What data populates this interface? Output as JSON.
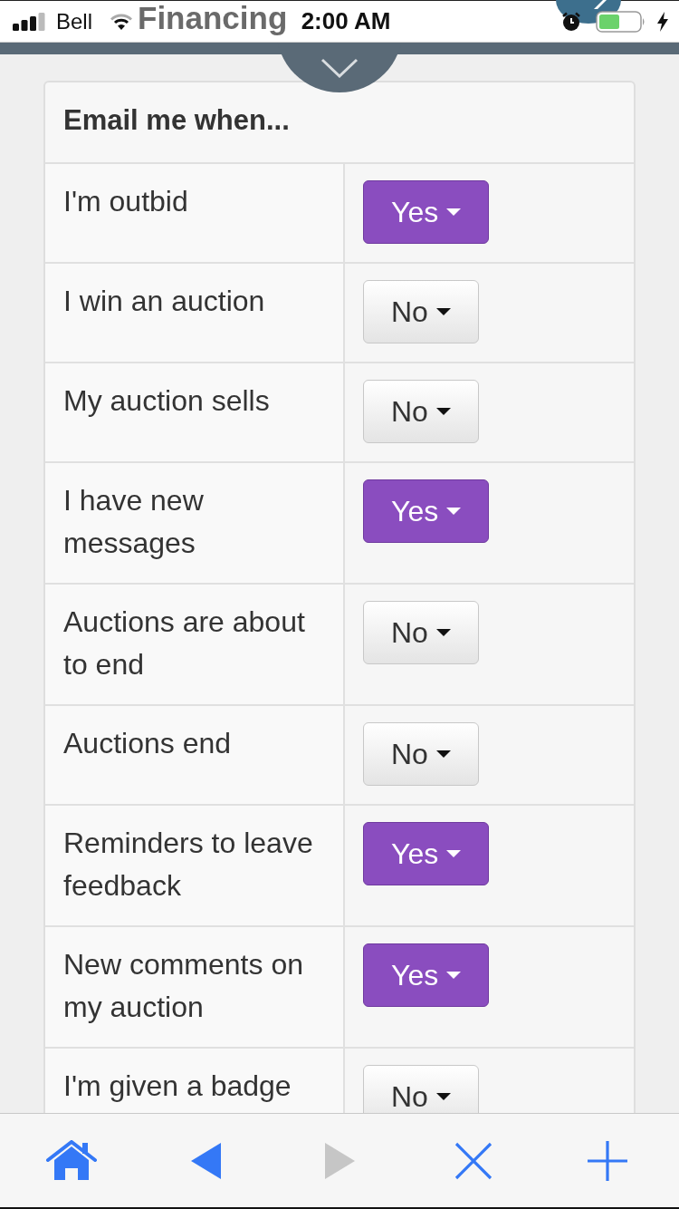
{
  "status_bar": {
    "carrier": "Bell",
    "time": "2:00 AM"
  },
  "page_title": "Financing",
  "header_toggle": {
    "expanded": false
  },
  "notifications": {
    "heading": "Email me when...",
    "rows": [
      {
        "label": "I'm outbid",
        "value": "Yes",
        "on": true
      },
      {
        "label": "I win an auction",
        "value": "No",
        "on": false
      },
      {
        "label": "My auction sells",
        "value": "No",
        "on": false
      },
      {
        "label": "I have new messages",
        "value": "Yes",
        "on": true
      },
      {
        "label": "Auctions are about to end",
        "value": "No",
        "on": false
      },
      {
        "label": "Auctions end",
        "value": "No",
        "on": false
      },
      {
        "label": "Reminders to leave feedback",
        "value": "Yes",
        "on": true
      },
      {
        "label": "New comments on my auction",
        "value": "Yes",
        "on": true
      },
      {
        "label": "I'm given a badge",
        "value": "No",
        "on": false
      }
    ]
  },
  "toolbar": {
    "buttons": [
      {
        "kind": "home",
        "disabled": false
      },
      {
        "kind": "back",
        "disabled": false
      },
      {
        "kind": "forward",
        "disabled": true
      },
      {
        "kind": "close",
        "disabled": false
      },
      {
        "kind": "add",
        "disabled": false
      }
    ]
  }
}
